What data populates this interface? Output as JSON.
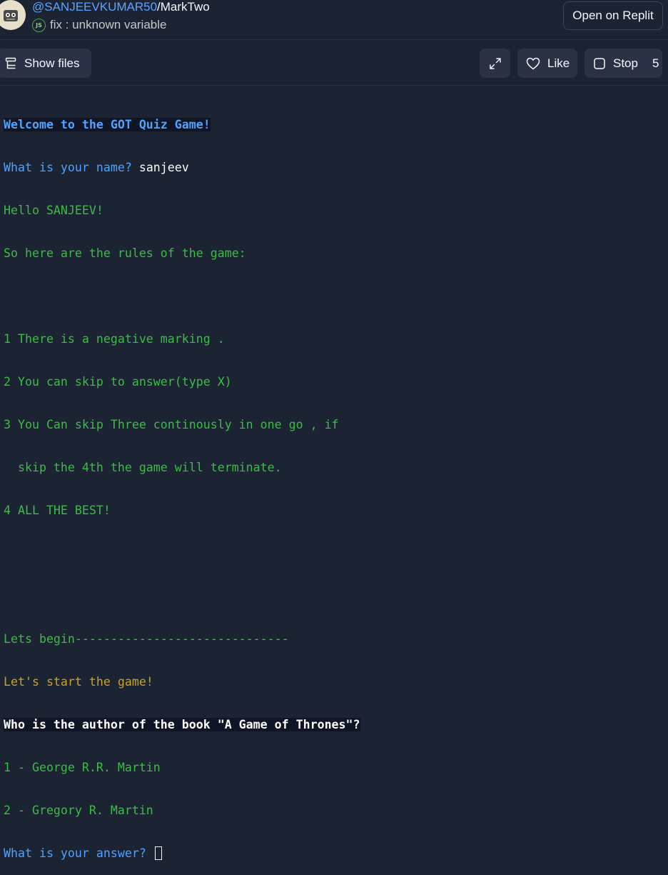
{
  "header": {
    "repl_owner": "@SANJEEVKUMAR50",
    "repl_separator": "/",
    "repl_name": "MarkTwo",
    "commit_message": "fix : unknown variable",
    "language_icon": "nodejs-icon",
    "open_button_label": "Open on Replit"
  },
  "toolbar": {
    "show_files_label": "Show files",
    "like_label": "Like",
    "stop_label": "Stop",
    "stop_count": "5"
  },
  "console": {
    "lines": [
      "Welcome to the GOT Quiz Game!",
      "What is your name? ",
      "sanjeev",
      "Hello SANJEEV!",
      "So here are the rules of the game:",
      "",
      "1 There is a negative marking .",
      "2 You can skip to answer(type X)",
      "3 You Can skip Three continously in one go , if",
      "  skip the 4th the game will terminate.",
      "4 ALL THE BEST!",
      "",
      "",
      "Lets begin------------------------------",
      "Let's start the game!",
      "Who is the author of the book \"A Game of Thrones\"?",
      "1 - George R.R. Martin",
      "2 - Gregory R. Martin",
      "What is your answer? "
    ]
  },
  "colors": {
    "background": "#1c2333",
    "prompt_blue": "#4ea3ff",
    "output_green": "#3dbb48",
    "output_gold": "#c9a227"
  }
}
